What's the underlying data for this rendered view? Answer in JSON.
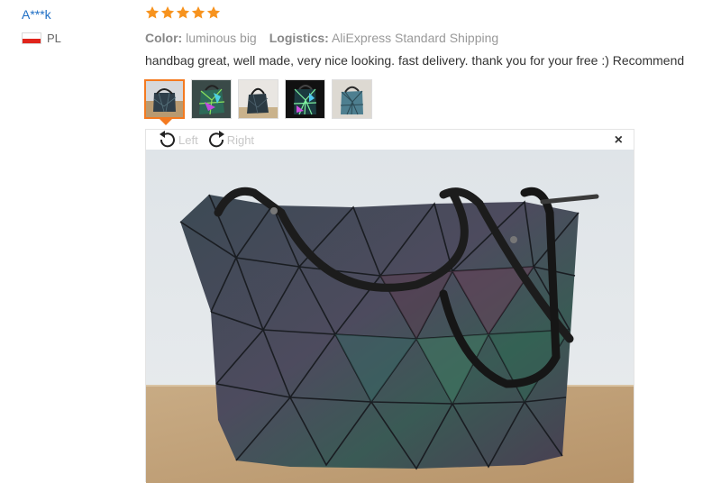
{
  "reviewer": {
    "name": "A***k",
    "country": "PL"
  },
  "review": {
    "rating": 5,
    "color_label": "Color:",
    "color_value": "luminous big",
    "logistics_label": "Logistics:",
    "logistics_value": "AliExpress Standard Shipping",
    "text": "handbag great, well made, very nice looking. fast delivery. thank you for your free :) Recommend"
  },
  "viewer": {
    "left_label": "Left",
    "right_label": "Right",
    "close_glyph": "×"
  },
  "colors": {
    "star": "#f7931e",
    "accent": "#f47a20",
    "link": "#1f6fc5",
    "flag_red": "#e0241c"
  }
}
